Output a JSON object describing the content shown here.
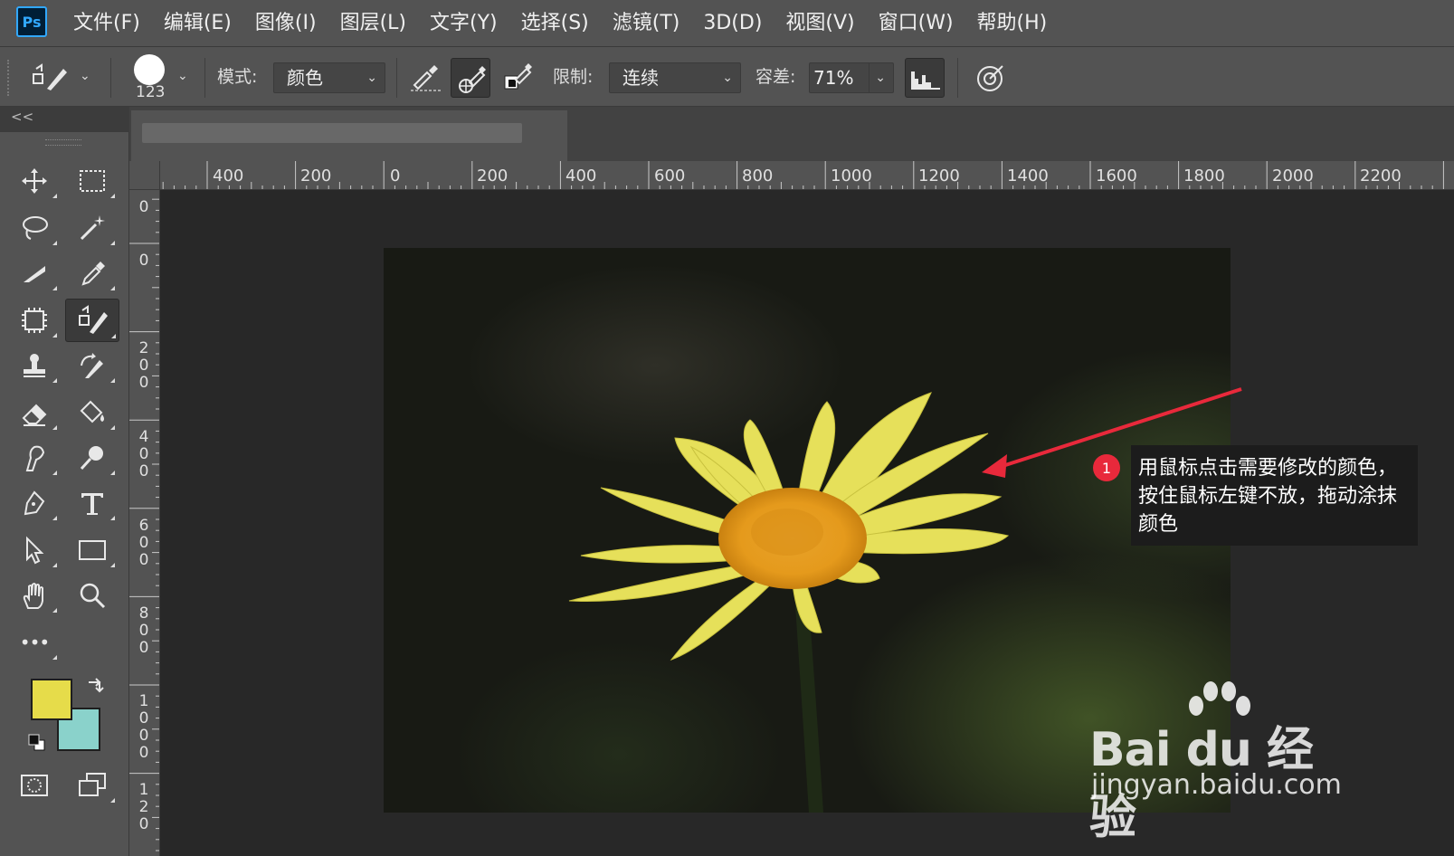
{
  "app": {
    "logo_text": "Ps"
  },
  "menubar": {
    "items": [
      "文件(F)",
      "编辑(E)",
      "图像(I)",
      "图层(L)",
      "文字(Y)",
      "选择(S)",
      "滤镜(T)",
      "3D(D)",
      "视图(V)",
      "窗口(W)",
      "帮助(H)"
    ]
  },
  "options": {
    "brush_size": "123",
    "mode_label": "模式:",
    "mode_value": "颜色",
    "limit_label": "限制:",
    "limit_value": "连续",
    "tolerance_label": "容差:",
    "tolerance_value": "71%"
  },
  "toolbar": {
    "collapse_label": "<<",
    "more_label": "•••",
    "foreground_color": "#e6dc4a",
    "background_color": "#8ad2cb"
  },
  "rulers": {
    "horizontal": [
      "400",
      "200",
      "0",
      "200",
      "400",
      "600",
      "800",
      "1000",
      "1200",
      "1400",
      "1600",
      "1800",
      "2000",
      "2200"
    ],
    "vertical": [
      "0",
      "0",
      "200",
      "400",
      "600",
      "800",
      "1000",
      "120"
    ]
  },
  "callout": {
    "number": "1",
    "text": "用鼠标点击需要修改的颜色，按住鼠标左键不放，拖动涂抹颜色",
    "arrow_color": "#e8293b"
  },
  "watermark": {
    "brand": "Bai du 经验",
    "url": "jingyan.baidu.com"
  }
}
